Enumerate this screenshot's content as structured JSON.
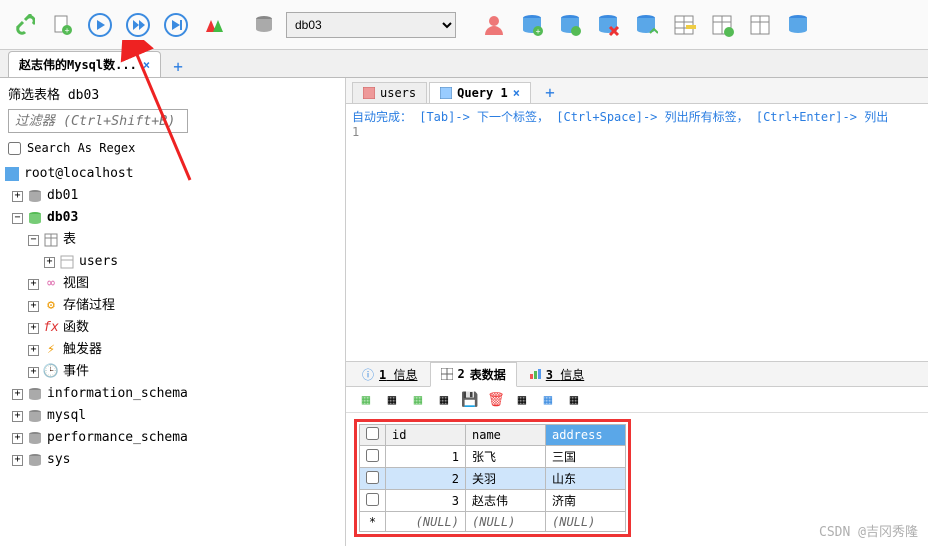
{
  "toolbar": {
    "db_selected": "db03"
  },
  "session_tab": {
    "label": "赵志伟的Mysql数..."
  },
  "sidebar": {
    "filter_title_prefix": "筛选表格",
    "filter_db": "db03",
    "filter_placeholder": "过滤器 (Ctrl+Shift+B)",
    "regex_label": "Search As Regex",
    "root": "root@localhost",
    "nodes": {
      "db01": "db01",
      "db03": "db03",
      "tables": "表",
      "users": "users",
      "views": "视图",
      "procs": "存储过程",
      "funcs": "函数",
      "triggers": "触发器",
      "events": "事件",
      "info_schema": "information_schema",
      "mysql": "mysql",
      "perf_schema": "performance_schema",
      "sys": "sys"
    }
  },
  "inner_tabs": {
    "users": "users",
    "query": "Query 1"
  },
  "editor": {
    "hint": "自动完成： [Tab]-> 下一个标签， [Ctrl+Space]-> 列出所有标签， [Ctrl+Enter]-> 列出",
    "line1": "1"
  },
  "bottom_tabs": {
    "info": "信息",
    "tabledata": "表数据",
    "info2": "信息"
  },
  "data_table": {
    "headers": {
      "id": "id",
      "name": "name",
      "address": "address"
    },
    "rows": [
      {
        "id": "1",
        "name": "张飞",
        "address": "三国"
      },
      {
        "id": "2",
        "name": "关羽",
        "address": "山东"
      },
      {
        "id": "3",
        "name": "赵志伟",
        "address": "济南"
      }
    ],
    "nullrow": {
      "marker": "*",
      "val": "(NULL)"
    }
  },
  "watermark": "CSDN @吉冈秀隆"
}
